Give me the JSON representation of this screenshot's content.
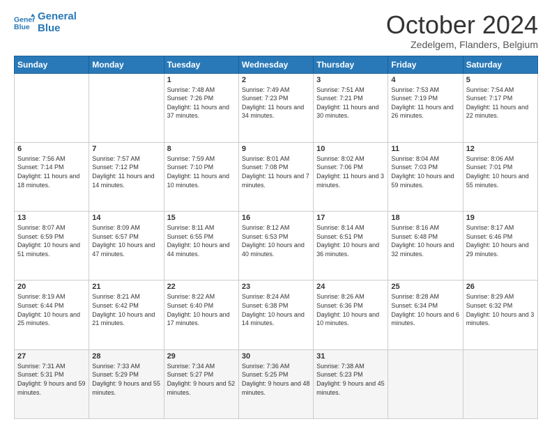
{
  "header": {
    "logo_line1": "General",
    "logo_line2": "Blue",
    "month": "October 2024",
    "location": "Zedelgem, Flanders, Belgium"
  },
  "weekdays": [
    "Sunday",
    "Monday",
    "Tuesday",
    "Wednesday",
    "Thursday",
    "Friday",
    "Saturday"
  ],
  "weeks": [
    [
      {
        "day": "",
        "sunrise": "",
        "sunset": "",
        "daylight": ""
      },
      {
        "day": "",
        "sunrise": "",
        "sunset": "",
        "daylight": ""
      },
      {
        "day": "1",
        "sunrise": "Sunrise: 7:48 AM",
        "sunset": "Sunset: 7:26 PM",
        "daylight": "Daylight: 11 hours and 37 minutes."
      },
      {
        "day": "2",
        "sunrise": "Sunrise: 7:49 AM",
        "sunset": "Sunset: 7:23 PM",
        "daylight": "Daylight: 11 hours and 34 minutes."
      },
      {
        "day": "3",
        "sunrise": "Sunrise: 7:51 AM",
        "sunset": "Sunset: 7:21 PM",
        "daylight": "Daylight: 11 hours and 30 minutes."
      },
      {
        "day": "4",
        "sunrise": "Sunrise: 7:53 AM",
        "sunset": "Sunset: 7:19 PM",
        "daylight": "Daylight: 11 hours and 26 minutes."
      },
      {
        "day": "5",
        "sunrise": "Sunrise: 7:54 AM",
        "sunset": "Sunset: 7:17 PM",
        "daylight": "Daylight: 11 hours and 22 minutes."
      }
    ],
    [
      {
        "day": "6",
        "sunrise": "Sunrise: 7:56 AM",
        "sunset": "Sunset: 7:14 PM",
        "daylight": "Daylight: 11 hours and 18 minutes."
      },
      {
        "day": "7",
        "sunrise": "Sunrise: 7:57 AM",
        "sunset": "Sunset: 7:12 PM",
        "daylight": "Daylight: 11 hours and 14 minutes."
      },
      {
        "day": "8",
        "sunrise": "Sunrise: 7:59 AM",
        "sunset": "Sunset: 7:10 PM",
        "daylight": "Daylight: 11 hours and 10 minutes."
      },
      {
        "day": "9",
        "sunrise": "Sunrise: 8:01 AM",
        "sunset": "Sunset: 7:08 PM",
        "daylight": "Daylight: 11 hours and 7 minutes."
      },
      {
        "day": "10",
        "sunrise": "Sunrise: 8:02 AM",
        "sunset": "Sunset: 7:06 PM",
        "daylight": "Daylight: 11 hours and 3 minutes."
      },
      {
        "day": "11",
        "sunrise": "Sunrise: 8:04 AM",
        "sunset": "Sunset: 7:03 PM",
        "daylight": "Daylight: 10 hours and 59 minutes."
      },
      {
        "day": "12",
        "sunrise": "Sunrise: 8:06 AM",
        "sunset": "Sunset: 7:01 PM",
        "daylight": "Daylight: 10 hours and 55 minutes."
      }
    ],
    [
      {
        "day": "13",
        "sunrise": "Sunrise: 8:07 AM",
        "sunset": "Sunset: 6:59 PM",
        "daylight": "Daylight: 10 hours and 51 minutes."
      },
      {
        "day": "14",
        "sunrise": "Sunrise: 8:09 AM",
        "sunset": "Sunset: 6:57 PM",
        "daylight": "Daylight: 10 hours and 47 minutes."
      },
      {
        "day": "15",
        "sunrise": "Sunrise: 8:11 AM",
        "sunset": "Sunset: 6:55 PM",
        "daylight": "Daylight: 10 hours and 44 minutes."
      },
      {
        "day": "16",
        "sunrise": "Sunrise: 8:12 AM",
        "sunset": "Sunset: 6:53 PM",
        "daylight": "Daylight: 10 hours and 40 minutes."
      },
      {
        "day": "17",
        "sunrise": "Sunrise: 8:14 AM",
        "sunset": "Sunset: 6:51 PM",
        "daylight": "Daylight: 10 hours and 36 minutes."
      },
      {
        "day": "18",
        "sunrise": "Sunrise: 8:16 AM",
        "sunset": "Sunset: 6:48 PM",
        "daylight": "Daylight: 10 hours and 32 minutes."
      },
      {
        "day": "19",
        "sunrise": "Sunrise: 8:17 AM",
        "sunset": "Sunset: 6:46 PM",
        "daylight": "Daylight: 10 hours and 29 minutes."
      }
    ],
    [
      {
        "day": "20",
        "sunrise": "Sunrise: 8:19 AM",
        "sunset": "Sunset: 6:44 PM",
        "daylight": "Daylight: 10 hours and 25 minutes."
      },
      {
        "day": "21",
        "sunrise": "Sunrise: 8:21 AM",
        "sunset": "Sunset: 6:42 PM",
        "daylight": "Daylight: 10 hours and 21 minutes."
      },
      {
        "day": "22",
        "sunrise": "Sunrise: 8:22 AM",
        "sunset": "Sunset: 6:40 PM",
        "daylight": "Daylight: 10 hours and 17 minutes."
      },
      {
        "day": "23",
        "sunrise": "Sunrise: 8:24 AM",
        "sunset": "Sunset: 6:38 PM",
        "daylight": "Daylight: 10 hours and 14 minutes."
      },
      {
        "day": "24",
        "sunrise": "Sunrise: 8:26 AM",
        "sunset": "Sunset: 6:36 PM",
        "daylight": "Daylight: 10 hours and 10 minutes."
      },
      {
        "day": "25",
        "sunrise": "Sunrise: 8:28 AM",
        "sunset": "Sunset: 6:34 PM",
        "daylight": "Daylight: 10 hours and 6 minutes."
      },
      {
        "day": "26",
        "sunrise": "Sunrise: 8:29 AM",
        "sunset": "Sunset: 6:32 PM",
        "daylight": "Daylight: 10 hours and 3 minutes."
      }
    ],
    [
      {
        "day": "27",
        "sunrise": "Sunrise: 7:31 AM",
        "sunset": "Sunset: 5:31 PM",
        "daylight": "Daylight: 9 hours and 59 minutes."
      },
      {
        "day": "28",
        "sunrise": "Sunrise: 7:33 AM",
        "sunset": "Sunset: 5:29 PM",
        "daylight": "Daylight: 9 hours and 55 minutes."
      },
      {
        "day": "29",
        "sunrise": "Sunrise: 7:34 AM",
        "sunset": "Sunset: 5:27 PM",
        "daylight": "Daylight: 9 hours and 52 minutes."
      },
      {
        "day": "30",
        "sunrise": "Sunrise: 7:36 AM",
        "sunset": "Sunset: 5:25 PM",
        "daylight": "Daylight: 9 hours and 48 minutes."
      },
      {
        "day": "31",
        "sunrise": "Sunrise: 7:38 AM",
        "sunset": "Sunset: 5:23 PM",
        "daylight": "Daylight: 9 hours and 45 minutes."
      },
      {
        "day": "",
        "sunrise": "",
        "sunset": "",
        "daylight": ""
      },
      {
        "day": "",
        "sunrise": "",
        "sunset": "",
        "daylight": ""
      }
    ]
  ]
}
